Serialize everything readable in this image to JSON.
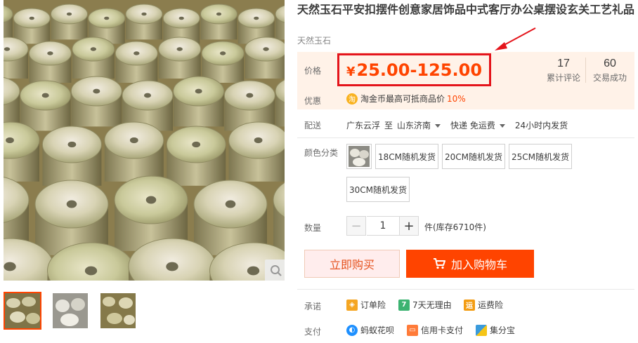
{
  "product": {
    "title": "天然玉石平安扣摆件创意家居饰品中式客厅办公桌摆设玄关工艺礼品",
    "subtitle": "天然玉石"
  },
  "price": {
    "label": "价格",
    "currency": "¥",
    "range": "25.00-125.00",
    "highlight_color": "#e4141b",
    "price_color": "#ff4400"
  },
  "stats": [
    {
      "value": "17",
      "label": "累计评论"
    },
    {
      "value": "60",
      "label": "交易成功"
    }
  ],
  "promo": {
    "label": "优惠",
    "icon": "coin-icon",
    "coin_glyph": "淘",
    "text": "淘金币最高可抵商品价",
    "percent": "10%"
  },
  "shipping": {
    "label": "配送",
    "origin": "广东云浮",
    "to": "至",
    "destination": "山东济南",
    "method": "快递 免运费",
    "dispatch": "24小时内发货"
  },
  "sku": {
    "label": "颜色分类",
    "options": [
      "18CM随机发货",
      "20CM随机发货",
      "25CM随机发货",
      "30CM随机发货"
    ]
  },
  "quantity": {
    "label": "数量",
    "value": "1",
    "minus": "−",
    "plus": "+",
    "stock": "件(库存6710件)"
  },
  "actions": {
    "buy_now": "立即购买",
    "add_to_cart": "加入购物车"
  },
  "commitment": {
    "label": "承诺",
    "items": [
      {
        "text": "订单险",
        "icon": "order-insurance-icon",
        "color": "#f5a623"
      },
      {
        "text": "7天无理由",
        "icon": "seven-day-return-icon",
        "color": "#3cb371"
      },
      {
        "text": "运费险",
        "icon": "freight-insurance-icon",
        "color": "#f39c12"
      }
    ]
  },
  "payment": {
    "label": "支付",
    "items": [
      {
        "text": "蚂蚁花呗",
        "icon": "huabei-icon",
        "color": "#1e90ff"
      },
      {
        "text": "信用卡支付",
        "icon": "credit-card-icon",
        "color": "#ff7b39"
      },
      {
        "text": "集分宝",
        "icon": "jifenbao-icon",
        "color": "#3a9bdc"
      }
    ]
  },
  "gallery": {
    "thumbs": 3,
    "active_thumb": 0,
    "zoom_icon": "zoom-icon"
  }
}
